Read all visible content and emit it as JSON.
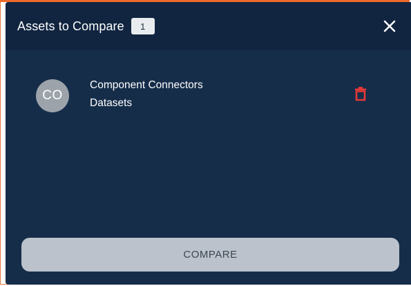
{
  "header": {
    "title": "Assets to Compare",
    "count": "1",
    "close_icon": "close-icon"
  },
  "assets": [
    {
      "avatar_initials": "CO",
      "name_line1": "Component Connectors",
      "name_line2": "Datasets",
      "delete_icon": "trash-icon"
    }
  ],
  "footer": {
    "compare_label": "COMPARE"
  },
  "colors": {
    "panel_background": "#162d4a",
    "header_background": "#112540",
    "badge_background": "#e9ecef",
    "avatar_background": "#9ca3aa",
    "delete_icon": "#e53935",
    "compare_button_background": "#bbc2cb",
    "accent_border": "#ee6a2a"
  }
}
